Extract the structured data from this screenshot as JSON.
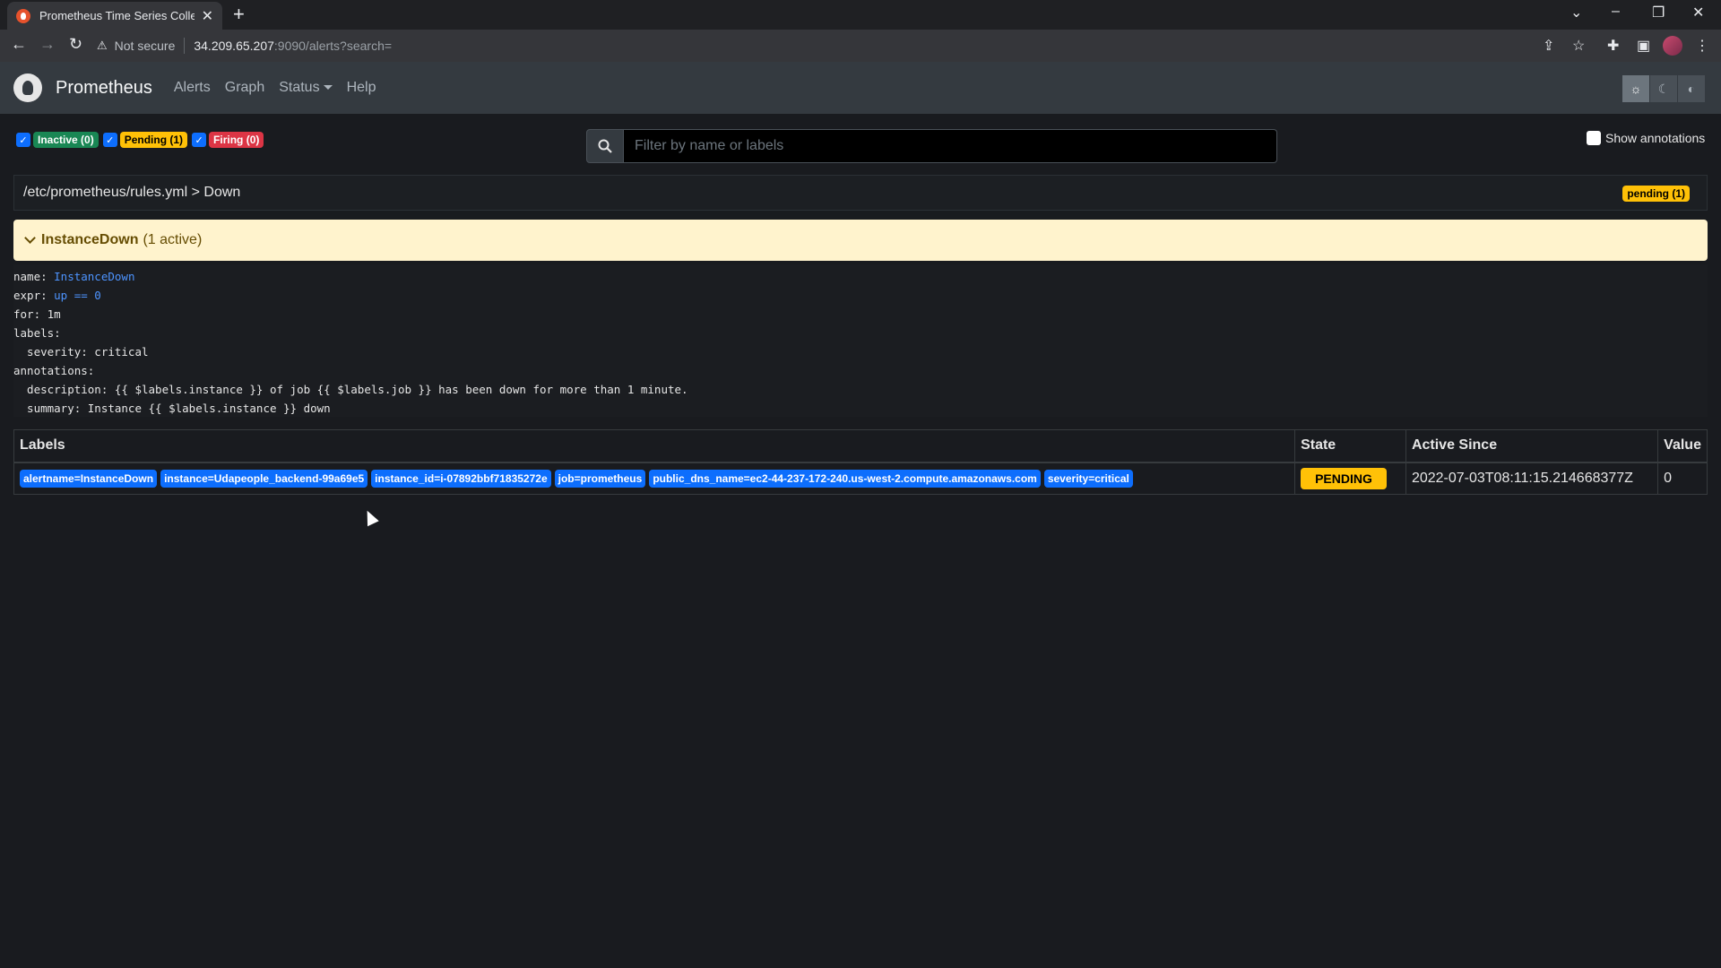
{
  "browser": {
    "tab_title": "Prometheus Time Series Collection",
    "new_tab": "+",
    "security": "Not secure",
    "url_host": "34.209.65.207",
    "url_path": ":9090/alerts?search="
  },
  "navbar": {
    "brand": "Prometheus",
    "links": [
      "Alerts",
      "Graph",
      "Status",
      "Help"
    ]
  },
  "filters": {
    "inactive": "Inactive (0)",
    "pending": "Pending (1)",
    "firing": "Firing (0)"
  },
  "search": {
    "placeholder": "Filter by name or labels"
  },
  "show_annotations": "Show annotations",
  "group": {
    "path": "/etc/prometheus/rules.yml > Down",
    "badge": "pending (1)"
  },
  "alert": {
    "name": "InstanceDown",
    "active": "(1 active)"
  },
  "rule": {
    "name_key": "name: ",
    "name_val": "InstanceDown",
    "expr_key": "expr: ",
    "expr_val": "up == 0",
    "for": "for: 1m",
    "labels": "labels:",
    "severity": "  severity: critical",
    "annotations": "annotations:",
    "description": "  description: {{ $labels.instance }} of job {{ $labels.job }} has been down for more than 1 minute.",
    "summary": "  summary: Instance {{ $labels.instance }} down"
  },
  "table": {
    "headers": [
      "Labels",
      "State",
      "Active Since",
      "Value"
    ],
    "row": {
      "labels": [
        "alertname=InstanceDown",
        "instance=Udapeople_backend-99a69e5",
        "instance_id=i-07892bbf71835272e",
        "job=prometheus",
        "public_dns_name=ec2-44-237-172-240.us-west-2.compute.amazonaws.com",
        "severity=critical"
      ],
      "state": "PENDING",
      "active_since": "2022-07-03T08:11:15.214668377Z",
      "value": "0"
    }
  }
}
